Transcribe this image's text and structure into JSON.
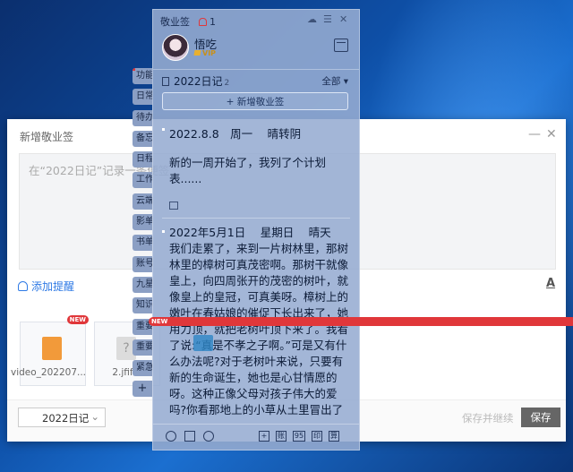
{
  "dialog": {
    "title": "新增敬业签",
    "placeholder": "在“2022日记”记录一条便签",
    "reminder_label": "添加提醒",
    "font_icon": "A",
    "attachments": [
      {
        "name": "video_202207...",
        "badge": "NEW",
        "type": "video"
      },
      {
        "name": "2.jfif",
        "badge": "",
        "type": "unknown"
      }
    ],
    "notebook_select": "2022日记",
    "save_continue_label": "保存并继续",
    "save_label": "保存"
  },
  "side_tabs": [
    "功能",
    "日常",
    "待办",
    "备忘",
    "日程",
    "工作",
    "云端",
    "影单",
    "书单",
    "账号",
    "九星",
    "知识",
    "重要",
    "重要",
    "紧急",
    "+"
  ],
  "new_badge": "NEW",
  "panel": {
    "app_title": "敬业签",
    "notification_count": "1",
    "username": "悟吃",
    "vip_label": "VIP",
    "notebook_name": "2022日记",
    "notebook_count": "2",
    "filter_label": "全部",
    "add_button_label": "+ 新增敬业签",
    "notes": [
      {
        "date_line": "2022.8.8　周一　 晴转阴",
        "body": "新的一周开始了，我列了个计划表......"
      },
      {
        "date_line": "2022年5月1日　 星期日　 晴天",
        "body": "我们走累了，来到一片树林里，那树林里的樟树可真茂密啊。那树干就像皇上，向四周张开的茂密的树叶，就像皇上的皇冠，可真美呀。樟树上的嫩叶在春姑娘的催促下长出来了，她用力顶，就把老树叶顶下来了。我看了说:“真是不孝之子啊。”可是又有什么办法呢?对于老树叶来说，只要有新的生命诞生，她也是心甘情愿的呀。这种正像父母对孩子伟大的爱吗?你看那地上的小草从土里冒出了小"
      }
    ],
    "toolbar_labels": [
      "账",
      "95",
      "印",
      "算"
    ]
  },
  "icons": {
    "bell": "bell-icon",
    "cloud": "cloud-icon",
    "menu": "menu-icon",
    "close": "close-icon",
    "calendar": "calendar-icon",
    "notebook": "notebook-icon",
    "history": "history-icon",
    "search": "search-icon",
    "archive": "archive-icon",
    "attach": "attachment-icon"
  },
  "colors": {
    "accent": "#2f7ae5",
    "panel": "#96acd2",
    "badge": "#e0373a"
  }
}
